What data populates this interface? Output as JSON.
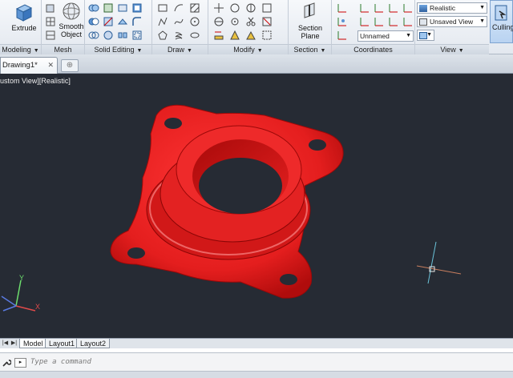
{
  "ribbon": {
    "panels": [
      {
        "title": "Modeling",
        "has_caret": true
      },
      {
        "title": "Mesh",
        "has_caret": false
      },
      {
        "title": "Solid Editing",
        "has_caret": true
      },
      {
        "title": "Draw",
        "has_caret": true
      },
      {
        "title": "Modify",
        "has_caret": true
      },
      {
        "title": "Section",
        "has_caret": true
      },
      {
        "title": "Coordinates",
        "has_caret": false
      },
      {
        "title": "View",
        "has_caret": true
      }
    ],
    "extrude_label": "Extrude",
    "smooth_object_label": "Smooth\nObject",
    "section_plane_label": "Section\nPlane",
    "visual_style_value": "Realistic",
    "named_view_value": "Unsaved View",
    "ucs_value": "Unnamed",
    "culling_label": "Culling"
  },
  "tabs": {
    "document": "Drawing1*",
    "close_glyph": "✕"
  },
  "viewport": {
    "label": "ustom View][Realistic]",
    "part_color": "#e82424",
    "background": "#262b34",
    "axis_labels": {
      "x": "X",
      "y": "Y"
    }
  },
  "layout_tabs": [
    "Model",
    "Layout1",
    "Layout2"
  ],
  "command": {
    "placeholder": "Type a command"
  },
  "icons": {
    "wrench": "wrench-icon",
    "command_prompt": "command-prompt-icon"
  }
}
